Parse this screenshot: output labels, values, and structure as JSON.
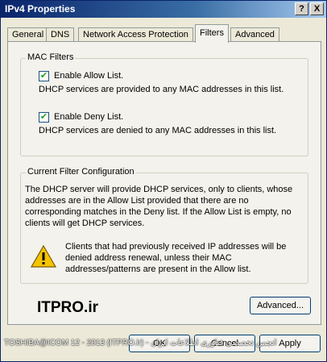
{
  "window": {
    "title": "IPv4 Properties",
    "help_glyph": "?",
    "close_glyph": "X"
  },
  "tabs": [
    {
      "label": "General"
    },
    {
      "label": "DNS"
    },
    {
      "label": "Network Access Protection"
    },
    {
      "label": "Filters"
    },
    {
      "label": "Advanced"
    }
  ],
  "mac_filters": {
    "legend": "MAC Filters",
    "allow": {
      "label": "Enable Allow List.",
      "checked": "✔",
      "description": "DHCP services are provided to any MAC addresses in this list."
    },
    "deny": {
      "label": "Enable Deny List.",
      "checked": "✔",
      "description": "DHCP services are denied to any MAC addresses in this list."
    }
  },
  "current_filter": {
    "legend": "Current Filter Configuration",
    "text": "The DHCP server will provide DHCP services, only to clients, whose addresses are in the Allow List provided that there are no corresponding matches in the Deny list. If the Allow List is empty, no clients will get DHCP services.",
    "warning": "Clients that had previously received IP addresses will be denied address renewal, unless their MAC addresses/patterns are present in the Allow list."
  },
  "logo_text": "ITPRO.ir",
  "buttons": {
    "advanced": "Advanced...",
    "ok": "OK",
    "cancel": "Cancel",
    "apply": "Apply"
  },
  "watermark": "TOSHIBA@ICOM 12 - 2013 (ITPRO.ir) - انجمن تخصصی فناوری اطلاعات ایران",
  "colors": {
    "titlebar": "#0a246a",
    "face": "#ece9d8",
    "panel": "#f3f2ec",
    "check": "#21a121",
    "warning": "#f5c400"
  }
}
